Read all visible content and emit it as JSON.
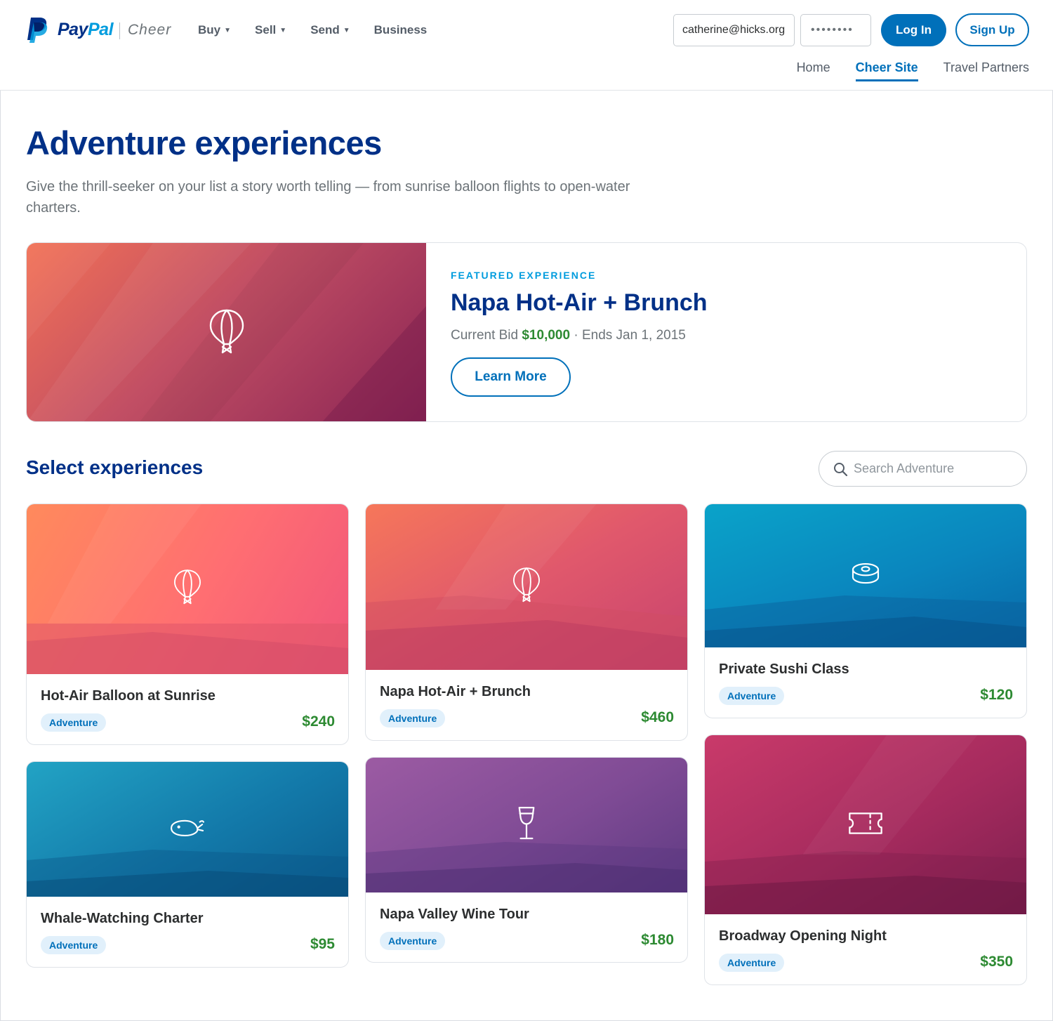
{
  "brand": {
    "pay": "Pay",
    "pal": "Pal",
    "sub": "Cheer"
  },
  "topnav": [
    {
      "label": "Buy",
      "has_menu": true
    },
    {
      "label": "Sell",
      "has_menu": true
    },
    {
      "label": "Send",
      "has_menu": true
    },
    {
      "label": "Business",
      "has_menu": false
    }
  ],
  "auth": {
    "email_value": "catherine@hicks.org",
    "password_value": "••••••••",
    "login_label": "Log In",
    "signup_label": "Sign Up"
  },
  "subnav": [
    {
      "label": "Home",
      "active": false
    },
    {
      "label": "Cheer Site",
      "active": true
    },
    {
      "label": "Travel Partners",
      "active": false
    }
  ],
  "hero": {
    "title": "Adventure experiences",
    "intro": "Give the thrill-seeker on your list a story worth telling — from sunrise balloon flights to open-water charters."
  },
  "featured": {
    "eyebrow": "FEATURED EXPERIENCE",
    "title": "Napa Hot-Air + Brunch",
    "bid_label": "Current Bid",
    "bid_value": "$10,000",
    "separator": "·",
    "ends": "Ends Jan 1, 2015",
    "button_label": "Learn More",
    "icon": "balloon-icon"
  },
  "section": {
    "title": "Select experiences",
    "search_placeholder": "Search Adventure"
  },
  "cards": [
    {
      "title": "Hot-Air Balloon at Sunrise",
      "tag": "Adventure",
      "price": "$240",
      "icon": "balloon-icon"
    },
    {
      "title": "Napa Hot-Air + Brunch",
      "tag": "Adventure",
      "price": "$460",
      "icon": "balloon-icon"
    },
    {
      "title": "Private Sushi Class",
      "tag": "Adventure",
      "price": "$120",
      "icon": "sushi-icon"
    },
    {
      "title": "Whale-Watching Charter",
      "tag": "Adventure",
      "price": "$95",
      "icon": "whale-icon"
    },
    {
      "title": "Napa Valley Wine Tour",
      "tag": "Adventure",
      "price": "$180",
      "icon": "wine-glass-icon"
    },
    {
      "title": "Broadway Opening Night",
      "tag": "Adventure",
      "price": "$350",
      "icon": "ticket-icon"
    }
  ],
  "colors": {
    "brand_dark": "#003087",
    "brand_blue": "#0070ba",
    "brand_light": "#009cde",
    "price_green": "#2d8a32"
  }
}
